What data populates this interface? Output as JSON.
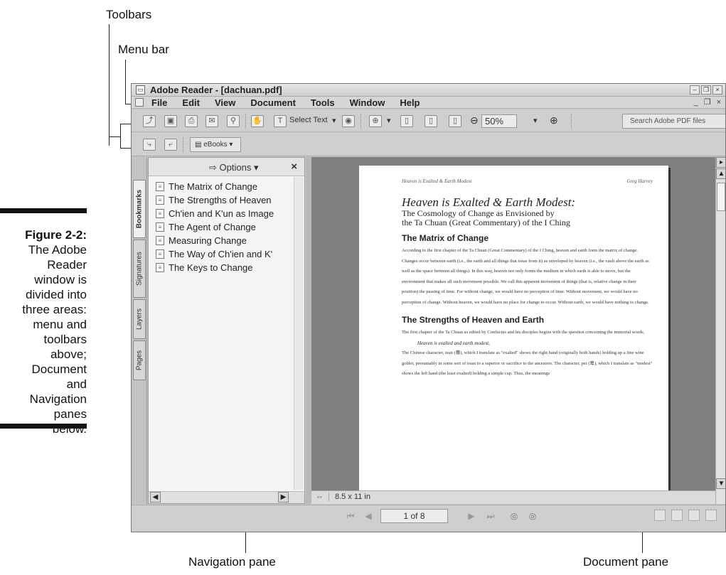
{
  "callouts": {
    "toolbars": "Toolbars",
    "menu_bar": "Menu bar",
    "navigation_pane": "Navigation pane",
    "document_pane": "Document pane"
  },
  "caption": {
    "label": "Figure 2-2:",
    "lines": [
      "The Adobe",
      "Reader",
      "window is",
      "divided into",
      "three areas:",
      "menu and",
      "toolbars",
      "above;",
      "Document",
      "and",
      "Navigation",
      "panes",
      "below."
    ]
  },
  "window": {
    "title": "Adobe Reader - [dachuan.pdf]",
    "menu": [
      "File",
      "Edit",
      "View",
      "Document",
      "Tools",
      "Window",
      "Help"
    ]
  },
  "toolbar": {
    "select_text": "Select Text",
    "zoom_value": "50%",
    "search_placeholder": "Search Adobe PDF files",
    "ebooks": "eBooks"
  },
  "side_tabs": [
    "Bookmarks",
    "Signatures",
    "Layers",
    "Pages"
  ],
  "nav_pane": {
    "options_label": "Options",
    "close_glyph": "×",
    "bookmarks": [
      "The Matrix of Change",
      "The Strengths of Heaven",
      "Ch'ien and K'un as Image",
      "The Agent of Change",
      "Measuring Change",
      "The Way of Ch'ien and K'",
      "The Keys to Change"
    ]
  },
  "document": {
    "header_left": "Heaven is Exalted & Earth Modest",
    "header_right": "Greg Harvey",
    "title": "Heaven is Exalted & Earth Modest:",
    "subtitle_1": "The Cosmology of Change as Envisioned by",
    "subtitle_2": "the Ta Chuan (Great Commentary) of the I Ching",
    "section_1": "The Matrix of Change",
    "para_1": "According to the first chapter of the Ta Chuan (Great Commentary) of the I Ching, heaven and earth form the matrix of change. Changes occur between earth (i.e., the earth and all things that issue from it) as enveloped by heaven (i.e., the vault above the earth as well as the space between all things). In this way, heaven not only forms the medium in which earth is able to move, but the environment that makes all such movement possible. We call this apparent movement of things (that is, relative change in their position) the passing of time. For without change, we would have no perception of time. Without movement, we would have no perception of change. Without heaven, we would have no place for change to occur. Without earth, we would have nothing to change.",
    "section_2": "The Strengths of Heaven and Earth",
    "para_2": "The first chapter of the Ta Chuan as edited by Confucius and his disciples begins with the question concerning the immortal words,",
    "quote": "Heaven is exalted and earth modest,",
    "para_3": "The Chinese character, tsun (尊), which I translate as \"exalted\" shows the right hand (originally both hands) holding up a fine wine goblet, presumably in some sort of toast to a superior or sacrifice to the ancestors. The character, pei (卑), which I translate as \"modest\" shows the left hand (the least exalted) holding a simple cup. Thus, the meanings",
    "page_size": "8.5 x 11 in"
  },
  "status": {
    "page_indicator": "1 of 8"
  }
}
